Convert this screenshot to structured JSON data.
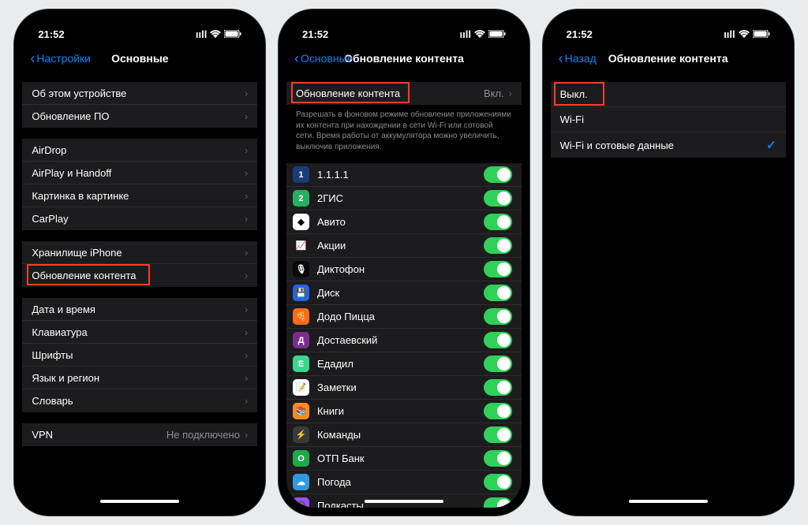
{
  "status": {
    "time": "21:52"
  },
  "phone1": {
    "back": "Настройки",
    "title": "Основные",
    "sections": [
      {
        "items": [
          {
            "label": "Об этом устройстве"
          },
          {
            "label": "Обновление ПО"
          }
        ]
      },
      {
        "items": [
          {
            "label": "AirDrop"
          },
          {
            "label": "AirPlay и Handoff"
          },
          {
            "label": "Картинка в картинке"
          },
          {
            "label": "CarPlay"
          }
        ]
      },
      {
        "items": [
          {
            "label": "Хранилище iPhone"
          },
          {
            "label": "Обновление контента",
            "highlighted": true
          }
        ]
      },
      {
        "items": [
          {
            "label": "Дата и время"
          },
          {
            "label": "Клавиатура"
          },
          {
            "label": "Шрифты"
          },
          {
            "label": "Язык и регион"
          },
          {
            "label": "Словарь"
          }
        ]
      },
      {
        "items": [
          {
            "label": "VPN",
            "value": "Не подключено"
          }
        ]
      }
    ]
  },
  "phone2": {
    "back": "Основные",
    "title": "Обновление контента",
    "header_row": {
      "label": "Обновление контента",
      "value": "Вкл.",
      "highlighted": true
    },
    "footer": "Разрешать в фоновом режиме обновление приложениями их контента при нахождении в сети Wi-Fi или сотовой сети. Время работы от аккумулятора можно увеличить, выключив приложения.",
    "apps": [
      {
        "label": "1.1.1.1",
        "color": "#1a3d7a",
        "glyph": "1"
      },
      {
        "label": "2ГИС",
        "color": "#27ae60",
        "glyph": "2"
      },
      {
        "label": "Авито",
        "color": "#ffffff",
        "glyph": "◆"
      },
      {
        "label": "Акции",
        "color": "#1a1a1a",
        "glyph": "📈"
      },
      {
        "label": "Диктофон",
        "color": "#0a0a0a",
        "glyph": "🎙"
      },
      {
        "label": "Диск",
        "color": "#2563eb",
        "glyph": "💾"
      },
      {
        "label": "Додо Пицца",
        "color": "#ff6b1a",
        "glyph": "🍕"
      },
      {
        "label": "Достаевский",
        "color": "#7b2d8e",
        "glyph": "Д"
      },
      {
        "label": "Едадил",
        "color": "#3dd68c",
        "glyph": "Е"
      },
      {
        "label": "Заметки",
        "color": "#ffffff",
        "glyph": "📝"
      },
      {
        "label": "Книги",
        "color": "#ff8c1a",
        "glyph": "📚"
      },
      {
        "label": "Команды",
        "color": "#3a3a3c",
        "glyph": "⚡"
      },
      {
        "label": "ОТП Банк",
        "color": "#1fa849",
        "glyph": "О"
      },
      {
        "label": "Погода",
        "color": "#3498db",
        "glyph": "☁"
      },
      {
        "label": "Подкасты",
        "color": "#9b4dff",
        "glyph": "🎧"
      }
    ]
  },
  "phone3": {
    "back": "Назад",
    "title": "Обновление контента",
    "options": [
      {
        "label": "Выкл.",
        "highlighted": true
      },
      {
        "label": "Wi-Fi"
      },
      {
        "label": "Wi-Fi и сотовые данные",
        "checked": true
      }
    ]
  }
}
